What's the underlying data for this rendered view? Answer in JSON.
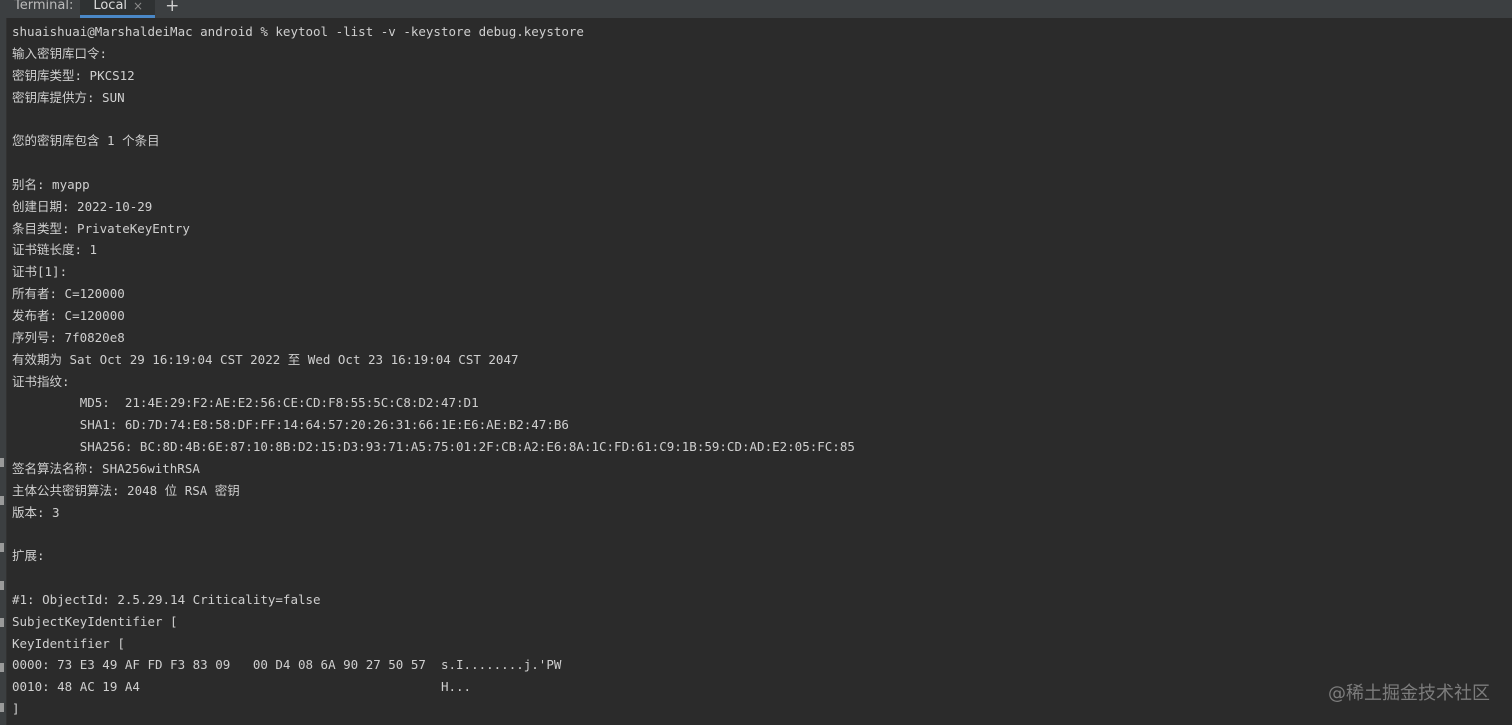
{
  "tabbar": {
    "title": "Terminal:",
    "tab_label": "Local",
    "close_glyph": "×",
    "add_glyph": "+"
  },
  "terminal": {
    "lines": [
      "shuaishuai@MarshaldeiMac android % keytool -list -v -keystore debug.keystore",
      "输入密钥库口令:",
      "密钥库类型: PKCS12",
      "密钥库提供方: SUN",
      "",
      "您的密钥库包含 1 个条目",
      "",
      "别名: myapp",
      "创建日期: 2022-10-29",
      "条目类型: PrivateKeyEntry",
      "证书链长度: 1",
      "证书[1]:",
      "所有者: C=120000",
      "发布者: C=120000",
      "序列号: 7f0820e8",
      "有效期为 Sat Oct 29 16:19:04 CST 2022 至 Wed Oct 23 16:19:04 CST 2047",
      "证书指纹:",
      "         MD5:  21:4E:29:F2:AE:E2:56:CE:CD:F8:55:5C:C8:D2:47:D1",
      "         SHA1: 6D:7D:74:E8:58:DF:FF:14:64:57:20:26:31:66:1E:E6:AE:B2:47:B6",
      "         SHA256: BC:8D:4B:6E:87:10:8B:D2:15:D3:93:71:A5:75:01:2F:CB:A2:E6:8A:1C:FD:61:C9:1B:59:CD:AD:E2:05:FC:85",
      "签名算法名称: SHA256withRSA",
      "主体公共密钥算法: 2048 位 RSA 密钥",
      "版本: 3",
      "",
      "扩展:",
      "",
      "#1: ObjectId: 2.5.29.14 Criticality=false",
      "SubjectKeyIdentifier [",
      "KeyIdentifier [",
      "0000: 73 E3 49 AF FD F3 83 09   00 D4 08 6A 90 27 50 57  s.I........j.'PW",
      "0010: 48 AC 19 A4                                        H...",
      "]"
    ]
  },
  "watermark": "@稀土掘金技术社区",
  "colors": {
    "background": "#2b2b2b",
    "tabbar": "#3c3f41",
    "text": "#cfcfcf",
    "active_tab_underline": "#4a88c7"
  }
}
